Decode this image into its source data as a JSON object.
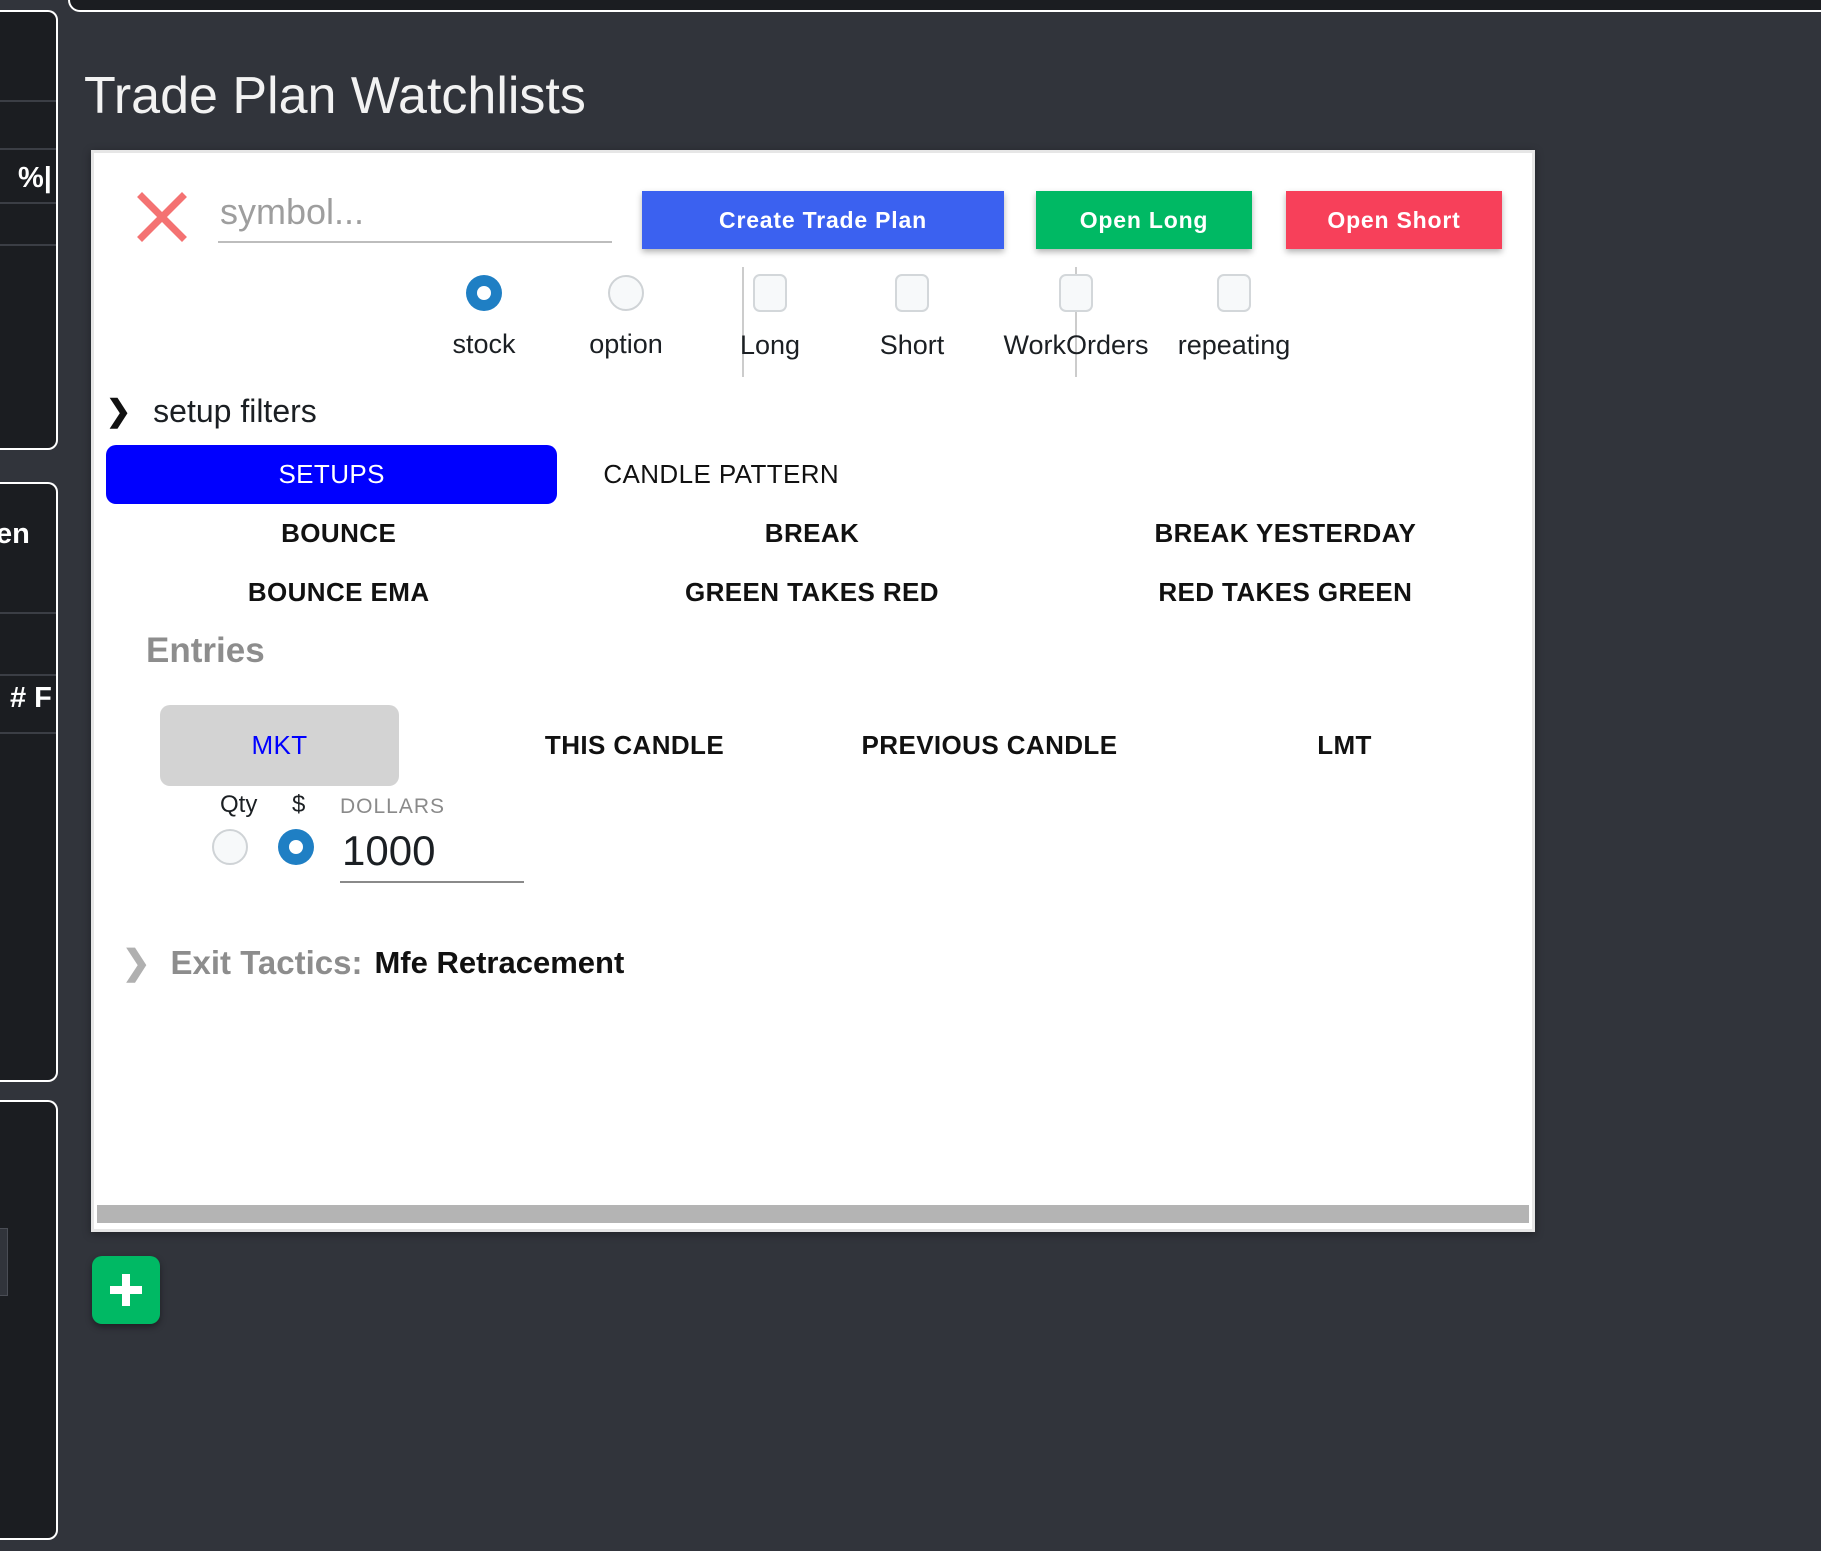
{
  "page": {
    "title": "Trade Plan Watchlists"
  },
  "sidebar": {
    "fragments": [
      {
        "label": "%|"
      },
      {
        "label": "en"
      },
      {
        "label": "# F"
      }
    ]
  },
  "symbol_row": {
    "clear_icon": "close-x-icon",
    "symbol_placeholder": "symbol...",
    "symbol_value": "",
    "create_label": "Create Trade Plan",
    "long_label": "Open Long",
    "short_label": "Open Short",
    "colors": {
      "create": "#3b61f0",
      "long": "#00b964",
      "short": "#f7405a",
      "clear_icon": "#f47272"
    }
  },
  "options": [
    {
      "name": "stock",
      "type": "radio",
      "checked": true
    },
    {
      "name": "option",
      "type": "radio",
      "checked": false
    },
    {
      "name": "Long",
      "type": "checkbox",
      "checked": false
    },
    {
      "name": "Short",
      "type": "checkbox",
      "checked": false
    },
    {
      "name": "WorkOrders",
      "type": "checkbox",
      "checked": false
    },
    {
      "name": "repeating",
      "type": "checkbox",
      "checked": false
    }
  ],
  "setup_filters": {
    "header": "setup filters",
    "expand_icon": "chevron-right-icon",
    "rows": [
      [
        {
          "label": "SETUPS",
          "selected": true
        },
        {
          "label": "CANDLE PATTERN",
          "selected": false
        },
        {
          "label": "",
          "selected": false
        }
      ],
      [
        {
          "label": "BOUNCE",
          "selected": false
        },
        {
          "label": "BREAK",
          "selected": false
        },
        {
          "label": "BREAK YESTERDAY",
          "selected": false
        }
      ],
      [
        {
          "label": "BOUNCE EMA",
          "selected": false
        },
        {
          "label": "GREEN TAKES RED",
          "selected": false
        },
        {
          "label": "RED TAKES GREEN",
          "selected": false
        }
      ]
    ],
    "selected_color": "#0000ff"
  },
  "entries": {
    "title": "Entries",
    "types": [
      {
        "label": "MKT",
        "selected": true
      },
      {
        "label": "THIS CANDLE",
        "selected": false
      },
      {
        "label": "PREVIOUS CANDLE",
        "selected": false
      },
      {
        "label": "LMT",
        "selected": false
      }
    ],
    "selected_bg": "#d3d3d3",
    "selected_fg": "#0000ff",
    "qty_label": "Qty",
    "dollar_label": "$",
    "amount_caption": "DOLLARS",
    "amount_value": "1000",
    "qty_selected": false,
    "dollar_selected": true
  },
  "exit_tactics": {
    "expand_icon": "chevron-right-icon",
    "label": "Exit Tactics:",
    "value": "Mfe Retracement"
  },
  "fab": {
    "icon": "plus-icon",
    "color": "#00b964"
  }
}
